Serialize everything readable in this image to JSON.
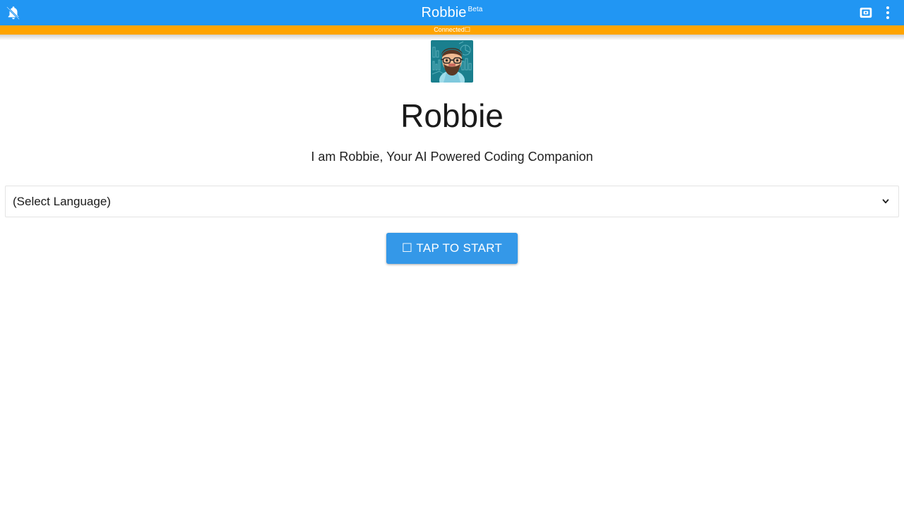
{
  "appbar": {
    "title": "Robbie",
    "badge": "Beta",
    "notifications_icon": "bell-off-icon",
    "cast_icon": "cast-icon",
    "overflow_icon": "kebab-menu-icon",
    "background_color": "#2196f3"
  },
  "status": {
    "text": "Connected",
    "glyph": "☐",
    "background_color": "#ffa400",
    "text_color": "#ffffff"
  },
  "main": {
    "avatar_alt": "robbie-avatar",
    "title": "Robbie",
    "subtitle": "I am Robbie, Your AI Powered Coding Companion"
  },
  "language_select": {
    "value": "(Select Language)",
    "options": [
      "(Select Language)"
    ]
  },
  "start": {
    "glyph": "☐",
    "label": "TAP TO START",
    "background_color": "#3498e8",
    "text_color": "#ffffff"
  }
}
